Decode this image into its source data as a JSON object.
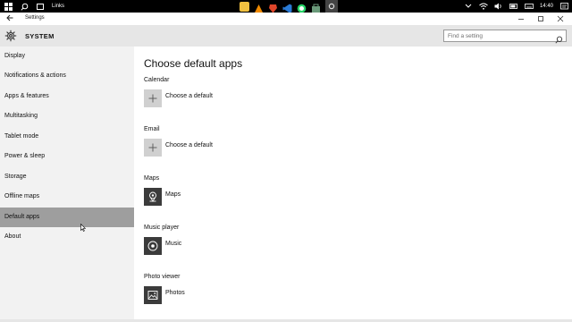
{
  "taskbar": {
    "links_label": "Links",
    "clock": "14:40",
    "apps": [
      {
        "name": "file-explorer-icon",
        "color": "#f0c040"
      },
      {
        "name": "vlc-icon",
        "color": "#f08a00"
      },
      {
        "name": "brave-icon",
        "color": "#e0462a"
      },
      {
        "name": "whatsapp-icon",
        "color": "#25d366"
      },
      {
        "name": "vscode-icon",
        "color": "#2a7bd6"
      },
      {
        "name": "store-icon",
        "color": "#6a9a7a"
      },
      {
        "name": "settings-app-icon",
        "color": "#cccccc"
      }
    ]
  },
  "window": {
    "title": "Settings"
  },
  "header": {
    "title": "SYSTEM",
    "search_placeholder": "Find a setting"
  },
  "sidebar": {
    "items": [
      {
        "label": "Display"
      },
      {
        "label": "Notifications & actions"
      },
      {
        "label": "Apps & features"
      },
      {
        "label": "Multitasking"
      },
      {
        "label": "Tablet mode"
      },
      {
        "label": "Power & sleep"
      },
      {
        "label": "Storage"
      },
      {
        "label": "Offline maps"
      },
      {
        "label": "Default apps"
      },
      {
        "label": "About"
      }
    ],
    "selected": "Default apps"
  },
  "main": {
    "title": "Choose default apps",
    "sections": [
      {
        "label": "Calendar",
        "app": "Choose a default",
        "icon": "plus-icon"
      },
      {
        "label": "Email",
        "app": "Choose a default",
        "icon": "plus-icon"
      },
      {
        "label": "Maps",
        "app": "Maps",
        "icon": "maps-icon"
      },
      {
        "label": "Music player",
        "app": "Music",
        "icon": "music-icon"
      },
      {
        "label": "Photo viewer",
        "app": "Photos",
        "icon": "photos-icon"
      }
    ]
  },
  "colors": {
    "header_bg": "#e6e6e6",
    "sidebar_bg": "#f2f2f2",
    "selected_bg": "#9e9e9e",
    "tile_empty": "#d0d0d0",
    "tile_app": "#3b3b3b"
  }
}
